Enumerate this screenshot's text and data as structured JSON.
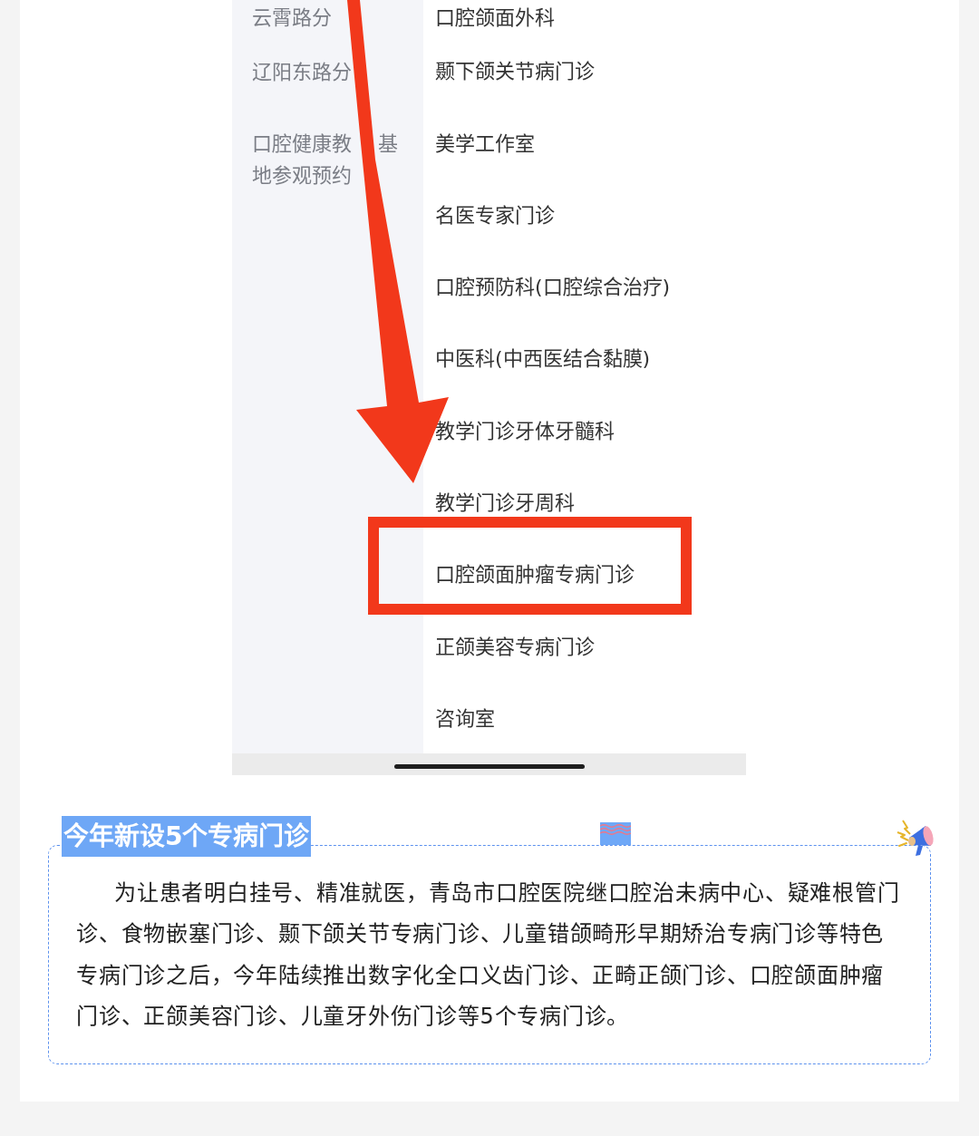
{
  "screenshot": {
    "branches": [
      {
        "lines": [
          [
            "云霄路分"
          ]
        ]
      },
      {
        "lines": [
          [
            "辽阳东路分"
          ]
        ]
      },
      {
        "lines": [
          [
            "口腔健康教",
            "基"
          ],
          [
            "地参观预约"
          ]
        ]
      }
    ],
    "departments": [
      {
        "label": "口腔颌面外科",
        "highlighted": false
      },
      {
        "label": "颞下颌关节病门诊",
        "highlighted": false
      },
      {
        "label": "美学工作室",
        "highlighted": false
      },
      {
        "label": "名医专家门诊",
        "highlighted": false
      },
      {
        "label": "口腔预防科(口腔综合治疗)",
        "highlighted": false
      },
      {
        "label": "中医科(中西医结合黏膜)",
        "highlighted": false
      },
      {
        "label": "教学门诊牙体牙髓科",
        "highlighted": false
      },
      {
        "label": "教学门诊牙周科",
        "highlighted": false
      },
      {
        "label": "口腔颌面肿瘤专病门诊",
        "highlighted": true
      },
      {
        "label": "正颌美容专病门诊",
        "highlighted": false
      },
      {
        "label": "咨询室",
        "highlighted": false
      }
    ]
  },
  "notice": {
    "title": "今年新设5个专病门诊",
    "body": "为让患者明白挂号、精准就医，青岛市口腔医院继口腔治未病中心、疑难根管门诊、食物嵌塞门诊、颞下颌关节专病门诊、儿童错颌畸形早期矫治专病门诊等特色专病门诊之后，今年陆续推出数字化全口义齿门诊、正畸正颌门诊、口腔颌面肿瘤门诊、正颌美容门诊、儿童牙外伤门诊等5个专病门诊。"
  }
}
